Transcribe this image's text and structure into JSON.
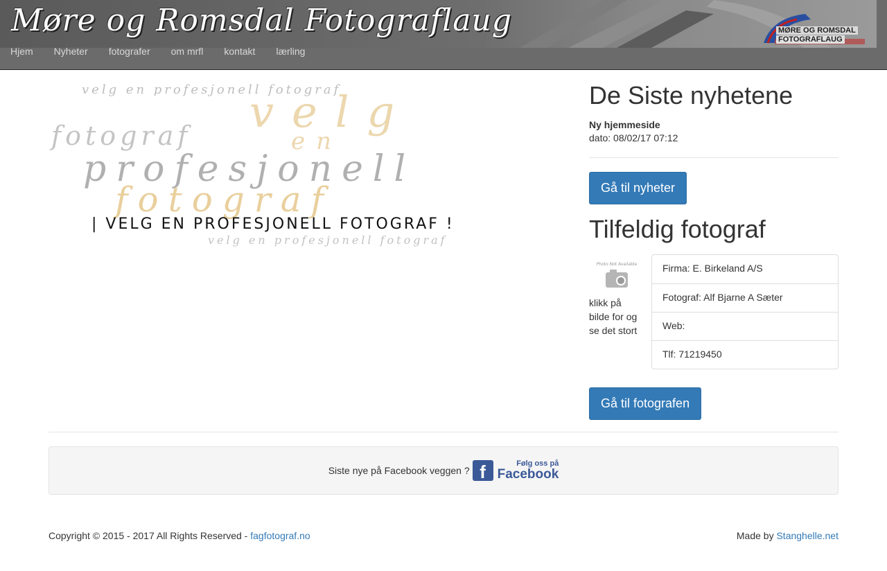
{
  "header": {
    "site_title": "Møre og Romsdal Fotograflaug",
    "logo_line1": "MØRE OG ROMSDAL",
    "logo_line2": "FOTOGRAFLAUG",
    "nav": [
      {
        "label": "Hjem"
      },
      {
        "label": "Nyheter"
      },
      {
        "label": "fotografer"
      },
      {
        "label": "om mrfl"
      },
      {
        "label": "kontakt"
      },
      {
        "label": "lærling"
      }
    ]
  },
  "hero": {
    "line_top": "velg en profesjonell fotograf",
    "word_velg": "velg",
    "word_en": "en",
    "word_fotograf_left": "fotograf",
    "word_profesjonell": "profesjonell",
    "word_fotograf_gold": "fotograf",
    "banner_caps": "| VELG EN PROFESJONELL FOTOGRAF !",
    "line_bottom": "velg en profesjonell fotograf"
  },
  "news": {
    "heading": "De Siste nyhetene",
    "item_title": "Ny hjemmeside",
    "item_date": "dato: 08/02/17 07:12",
    "button": "Gå til nyheter"
  },
  "photographer": {
    "heading": "Tilfeldig fotograf",
    "thumb_text": "Photo Not Available",
    "caption": "klikk på bilde for og se det stort",
    "details": [
      "Firma: E. Birkeland A/S",
      "Fotograf: Alf Bjarne A Sæter",
      "Web:",
      "Tlf: 71219450"
    ],
    "button": "Gå til fotografen"
  },
  "facebook": {
    "text": "Siste nye på Facebook veggen ?",
    "badge_f": "f",
    "badge_small": "Følg oss på",
    "badge_big": "Facebook"
  },
  "footer": {
    "copyright": "Copyright © 2015 - 2017 All Rights Reserved - ",
    "copyright_link": "fagfotograf.no",
    "madeby": "Made by ",
    "madeby_link": "Stanghelle.net"
  },
  "colors": {
    "header_bg": "#6b6b6b",
    "primary": "#337ab7",
    "gold": "#e6c78f",
    "facebook_blue": "#3b5998"
  }
}
